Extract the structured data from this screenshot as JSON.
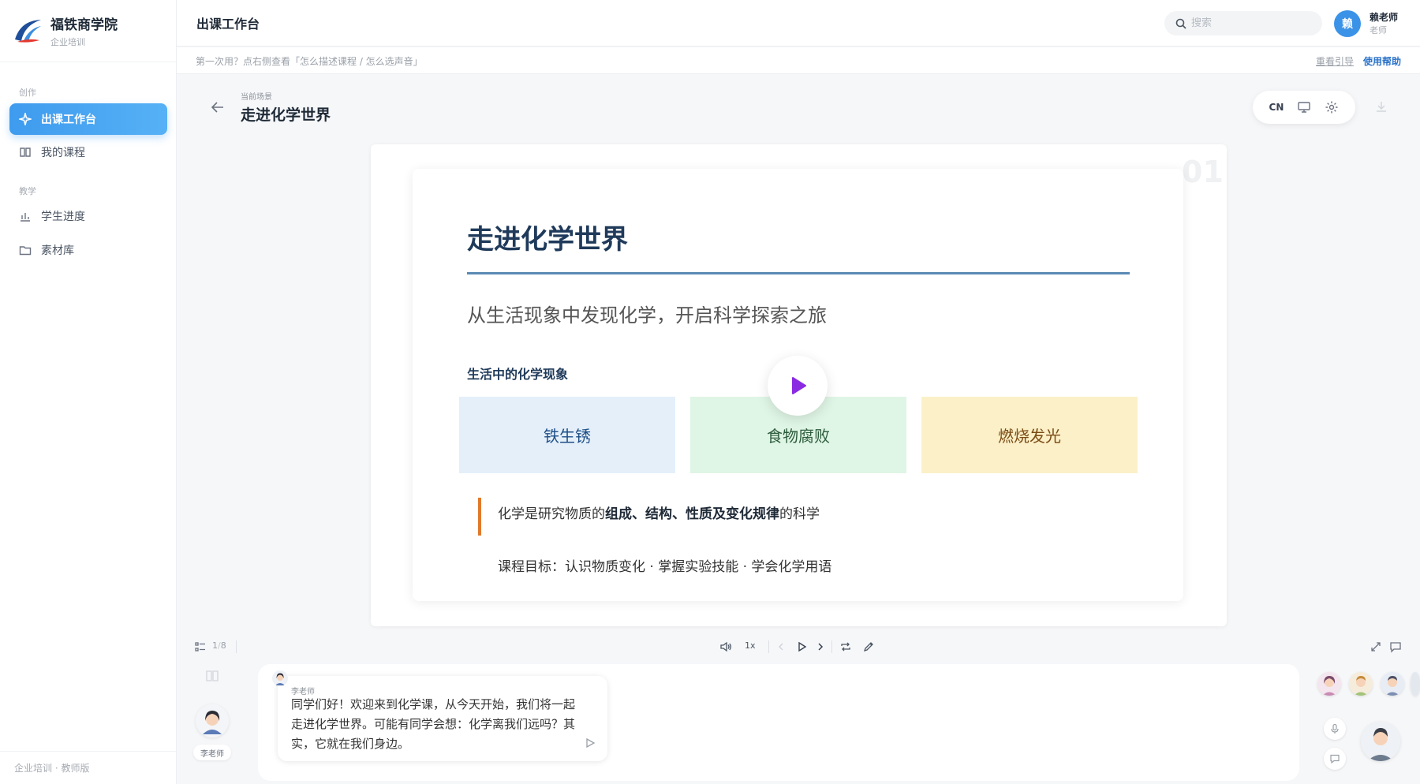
{
  "brand": {
    "name": "福铁商学院",
    "sub": "企业培训"
  },
  "sidebar": {
    "groups": [
      {
        "label": "创作",
        "items": [
          {
            "label": "出课工作台",
            "icon": "sparkle-icon",
            "active": true
          },
          {
            "label": "我的课程",
            "icon": "book-icon"
          }
        ]
      },
      {
        "label": "教学",
        "items": [
          {
            "label": "学生进度",
            "icon": "bar-chart-icon"
          },
          {
            "label": "素材库",
            "icon": "folder-icon"
          }
        ]
      }
    ],
    "footer": "企业培训 · 教师版"
  },
  "header": {
    "title": "出课工作台",
    "search_placeholder": "搜索",
    "user": {
      "initial": "赖",
      "name": "赖老师",
      "role": "老师"
    }
  },
  "hint": {
    "text": "第一次用？点右侧查看「怎么描述课程 / 怎么选声音」",
    "replay_label": "重看引导",
    "help_label": "使用帮助"
  },
  "scene": {
    "label": "当前场景",
    "title": "走进化学世界"
  },
  "toolbar": {
    "lang": "CN"
  },
  "slide": {
    "number": "01",
    "title": "走进化学世界",
    "subtitle": "从生活现象中发现化学，开启科学探索之旅",
    "section": "生活中的化学现象",
    "cards": [
      "铁生锈",
      "食物腐败",
      "燃烧发光"
    ],
    "quote": {
      "pre": "化学是研究物质的",
      "bold": "组成、结构、性质及变化规律",
      "post": "的科学"
    },
    "goal": "课程目标：认识物质变化 · 掌握实验技能 · 学会化学用语"
  },
  "controls": {
    "page_current": "1",
    "page_sep": "/",
    "page_total": "8",
    "speed": "1x"
  },
  "teacher": {
    "name": "李老师"
  },
  "message": {
    "speaker": "李老师",
    "text": "同学们好！欢迎来到化学课，从今天开始，我们将一起走进化学世界。可能有同学会想：化学离我们远吗？其实，它就在我们身边。"
  },
  "colors": {
    "accent": "#3e9bee",
    "title": "#1f3a5a",
    "rule": "#5a8ab5",
    "play": "#8a2be2",
    "quote_bar": "#e07a2c"
  }
}
